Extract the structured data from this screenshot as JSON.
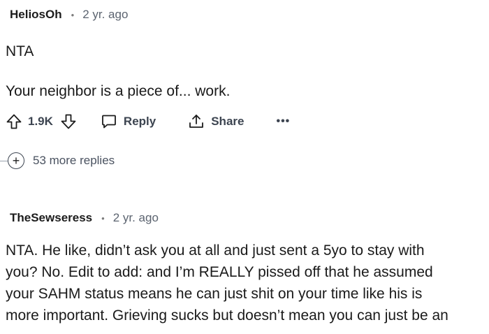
{
  "comment1": {
    "username": "HeliosOh",
    "separator": "•",
    "age": "2 yr. ago",
    "paragraphs": [
      "NTA",
      "Your neighbor is a piece of... work."
    ],
    "actions": {
      "vote_count": "1.9K",
      "reply_label": "Reply",
      "share_label": "Share",
      "more_label": "•••"
    },
    "more_replies": "53 more replies"
  },
  "comment2": {
    "username": "TheSewseress",
    "separator": "•",
    "age": "2 yr. ago",
    "lines": [
      "NTA. He like, didn’t ask you at all and just sent a 5yo to stay with",
      "you? No. Edit to add: and I’m REALLY pissed off that he assumed",
      "your SAHM status means he can just shit on your time like his is",
      "more important. Grieving sucks but doesn’t mean you can just be an"
    ]
  },
  "icons": {
    "upvote": "arrow-up-outline",
    "downvote": "arrow-down-outline",
    "reply": "speech-bubble",
    "share": "upload-arrow",
    "more": "ellipsis",
    "expand": "circle-plus"
  }
}
